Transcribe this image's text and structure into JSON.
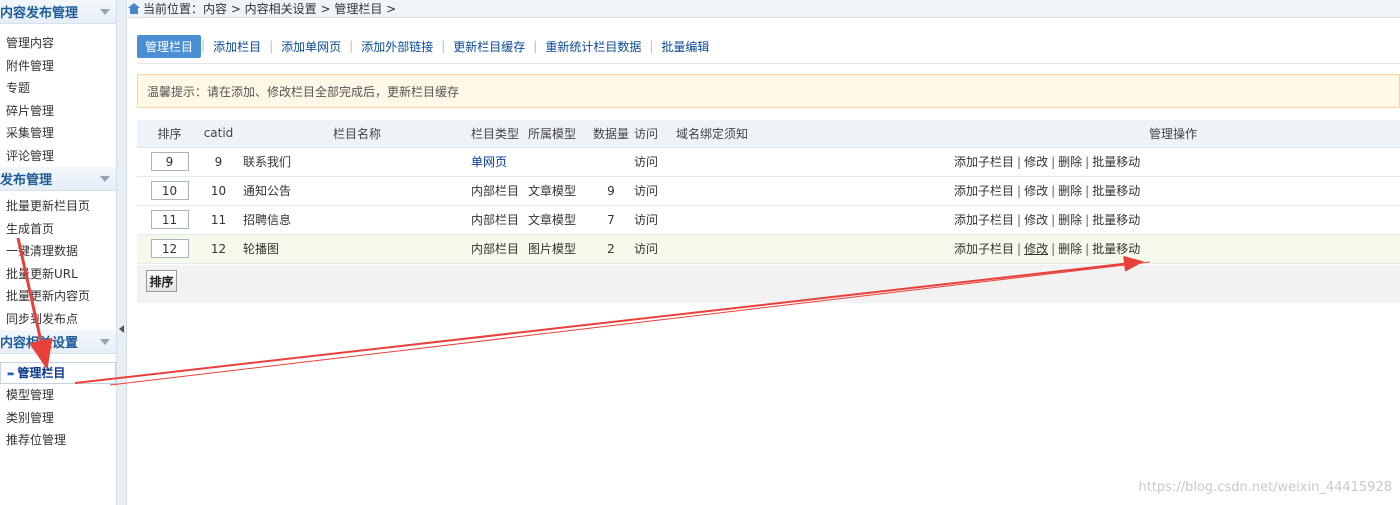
{
  "sidebar": {
    "sections": [
      {
        "title": "内容发布管理",
        "items": [
          "管理内容",
          "附件管理",
          "专题",
          "碎片管理",
          "采集管理",
          "评论管理"
        ]
      },
      {
        "title": "发布管理",
        "items": [
          "批量更新栏目页",
          "生成首页",
          "一键清理数据",
          "批量更新URL",
          "批量更新内容页",
          "同步到发布点"
        ]
      },
      {
        "title": "内容相关设置",
        "items": [
          "管理栏目",
          "模型管理",
          "类别管理",
          "推荐位管理"
        ]
      }
    ]
  },
  "breadcrumb": "当前位置：内容 > 内容相关设置 > 管理栏目 >",
  "toolbar": {
    "buttons": [
      "管理栏目",
      "添加栏目",
      "添加单网页",
      "添加外部链接",
      "更新栏目缓存",
      "重新统计栏目数据",
      "批量编辑"
    ]
  },
  "tip": "温馨提示：请在添加、修改栏目全部完成后，更新栏目缓存",
  "table": {
    "headers": [
      "排序",
      "catid",
      "栏目名称",
      "栏目类型",
      "所属模型",
      "数据量",
      "访问",
      "域名绑定须知",
      "管理操作"
    ],
    "rows": [
      {
        "order": "9",
        "catid": "9",
        "name": "联系我们",
        "type": "单网页",
        "model": "",
        "count": "",
        "visit": "访问",
        "domain": ""
      },
      {
        "order": "10",
        "catid": "10",
        "name": "通知公告",
        "type": "内部栏目",
        "model": "文章模型",
        "count": "9",
        "visit": "访问",
        "domain": ""
      },
      {
        "order": "11",
        "catid": "11",
        "name": "招聘信息",
        "type": "内部栏目",
        "model": "文章模型",
        "count": "7",
        "visit": "访问",
        "domain": ""
      },
      {
        "order": "12",
        "catid": "12",
        "name": "轮播图",
        "type": "内部栏目",
        "model": "图片模型",
        "count": "2",
        "visit": "访问",
        "domain": ""
      }
    ],
    "ops": [
      "添加子栏目",
      "修改",
      "删除",
      "批量移动"
    ],
    "ops_sep": "|"
  },
  "sort_button": "排序",
  "watermark": "https://blog.csdn.net/weixin_44415928",
  "colors": {
    "accent": "#4a8fd3",
    "link": "#0b4a99",
    "annotation_arrow": "#e8403a"
  }
}
